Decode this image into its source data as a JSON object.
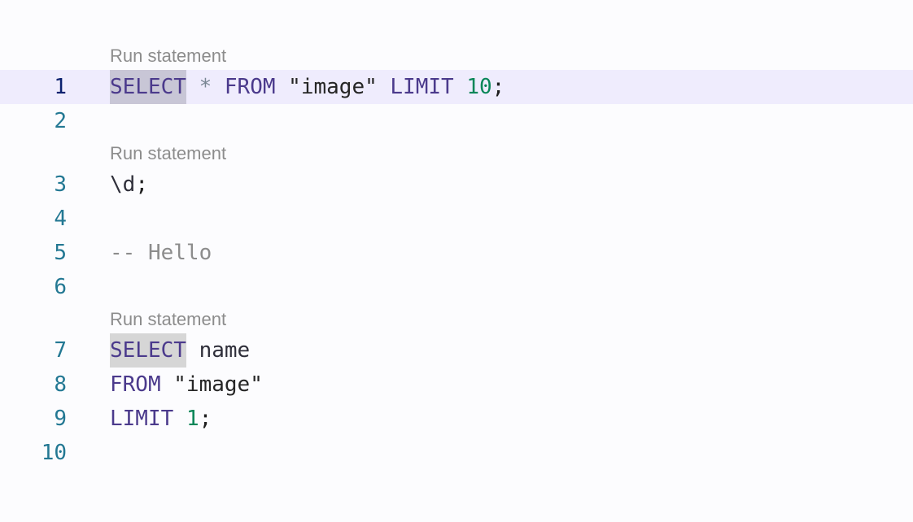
{
  "code_lens": {
    "run_statement_1": "Run statement",
    "run_statement_2": "Run statement",
    "run_statement_3": "Run statement"
  },
  "lines": [
    {
      "number": "1",
      "tokens": [
        "SELECT",
        " ",
        "*",
        " ",
        "FROM",
        " ",
        "\"image\"",
        " ",
        "LIMIT",
        " ",
        "10",
        ";"
      ]
    },
    {
      "number": "2"
    },
    {
      "number": "3",
      "tokens": [
        "\\d",
        ";"
      ]
    },
    {
      "number": "4"
    },
    {
      "number": "5",
      "tokens": [
        "-- Hello"
      ]
    },
    {
      "number": "6"
    },
    {
      "number": "7",
      "tokens": [
        "SELECT",
        " ",
        "name"
      ]
    },
    {
      "number": "8",
      "tokens": [
        "FROM",
        " ",
        "\"image\""
      ]
    },
    {
      "number": "9",
      "tokens": [
        "LIMIT",
        " ",
        "1",
        ";"
      ]
    },
    {
      "number": "10"
    }
  ],
  "colors": {
    "background": "#fcfcfe",
    "current_line": "#efecfd",
    "line_number": "#237893",
    "active_line_number": "#0b216f",
    "keyword": "#4b3a8c",
    "number": "#098658",
    "comment": "#8c8c8c",
    "code_lens": "#8c8c8c",
    "selection": "#c8c6d6"
  }
}
